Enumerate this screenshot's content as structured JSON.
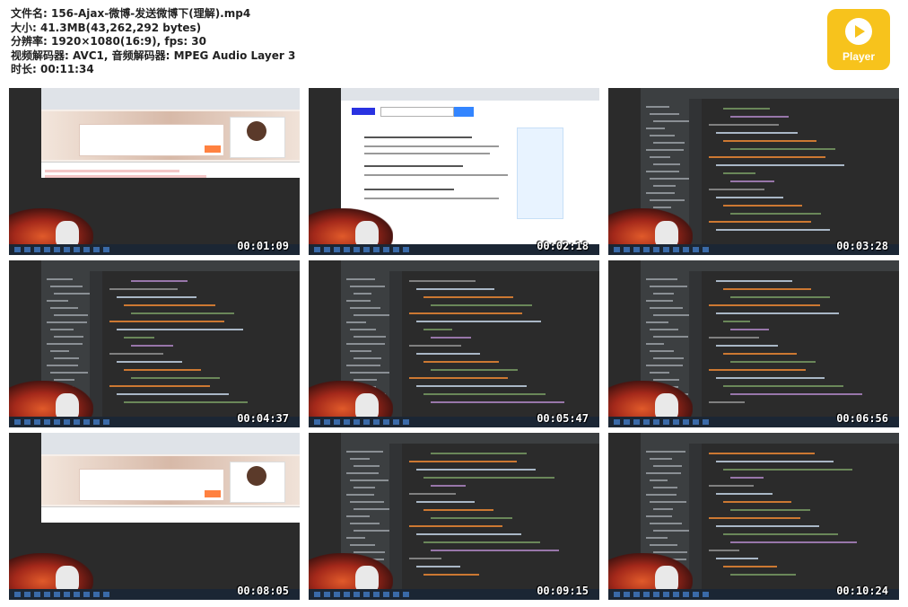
{
  "info": {
    "file_name": "文件名: 156-Ajax-微博-发送微博下(理解).mp4",
    "size": "大小: 41.3MB(43,262,292 bytes)",
    "resolution": "分辨率: 1920×1080(16:9), fps: 30",
    "codec": "视频解码器: AVC1, 音频解码器: MPEG Audio Layer 3",
    "duration": "时长: 00:11:34"
  },
  "logo": {
    "label": "Player",
    "color": "#f7c31c"
  },
  "thumbnails": [
    {
      "timestamp": "00:01:09",
      "scene": "browser-weibo"
    },
    {
      "timestamp": "00:02:18",
      "scene": "browser-baidu"
    },
    {
      "timestamp": "00:03:28",
      "scene": "ide"
    },
    {
      "timestamp": "00:04:37",
      "scene": "ide"
    },
    {
      "timestamp": "00:05:47",
      "scene": "ide"
    },
    {
      "timestamp": "00:06:56",
      "scene": "ide"
    },
    {
      "timestamp": "00:08:05",
      "scene": "browser-weibo"
    },
    {
      "timestamp": "00:09:15",
      "scene": "ide"
    },
    {
      "timestamp": "00:10:24",
      "scene": "ide"
    }
  ]
}
